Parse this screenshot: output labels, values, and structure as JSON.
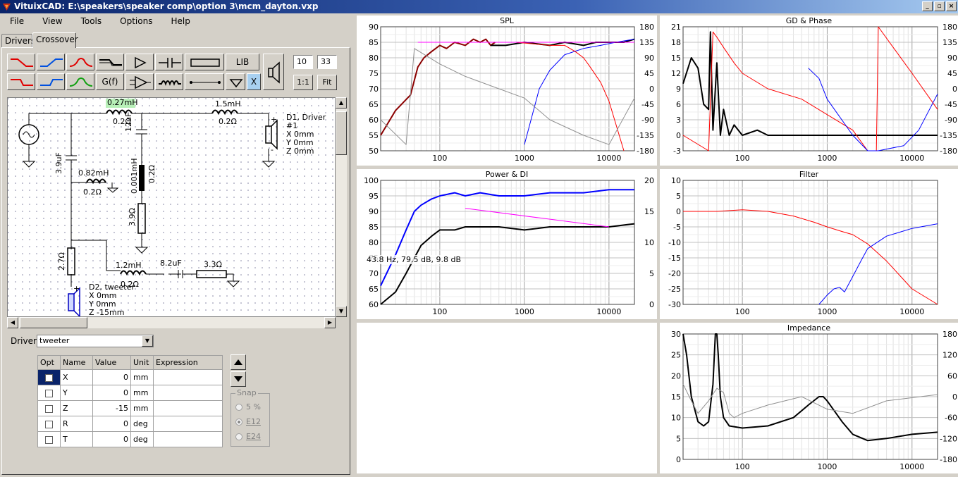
{
  "window": {
    "title": "VituixCAD: E:\\speakers\\speaker comp\\option 3\\mcm_dayton.vxp"
  },
  "menu": [
    "File",
    "View",
    "Tools",
    "Options",
    "Help"
  ],
  "tabs": [
    {
      "label": "Drivers"
    },
    {
      "label": "Crossover"
    }
  ],
  "toolbar": {
    "gf_label": "G(f)",
    "lib_label": "LIB",
    "x_label": "X",
    "one_to_one_label": "1:1",
    "fit_label": "Fit",
    "num1": "10",
    "num2": "33"
  },
  "schematic": {
    "labels": {
      "l1": "0.27mH",
      "l1r": "0.2Ω",
      "l2": "1.5mH",
      "l2r": "0.2Ω",
      "c1": "12uF",
      "c2": "3.9uF",
      "l3": "0.82mH",
      "l3r": "0.2Ω",
      "c3": "0.001mH",
      "c3r": "0.2Ω",
      "r1": "3.9Ω",
      "r2": "2.7Ω",
      "l4": "1.2mH",
      "l4r": "0.2Ω",
      "c4": "8.2uF",
      "r3": "3.3Ω"
    },
    "driver1": {
      "name": "D1, Driver #1",
      "x": "X 0mm",
      "y": "Y 0mm",
      "z": "Z 0mm"
    },
    "driver2": {
      "name": "D2, tweeter",
      "x": "X 0mm",
      "y": "Y 0mm",
      "z": "Z -15mm"
    }
  },
  "driver_select": {
    "label": "Driver",
    "value": "tweeter"
  },
  "param_table": {
    "headers": [
      "Opt",
      "Name",
      "Value",
      "Unit",
      "Expression"
    ],
    "rows": [
      {
        "name": "X",
        "value": "0",
        "unit": "mm"
      },
      {
        "name": "Y",
        "value": "0",
        "unit": "mm"
      },
      {
        "name": "Z",
        "value": "-15",
        "unit": "mm"
      },
      {
        "name": "R",
        "value": "0",
        "unit": "deg"
      },
      {
        "name": "T",
        "value": "0",
        "unit": "deg"
      }
    ]
  },
  "snap": {
    "label": "Snap",
    "options": [
      "5 %",
      "E12",
      "E24"
    ],
    "selected": "E12"
  },
  "chart_data": [
    {
      "title": "SPL",
      "type": "line",
      "x_scale": "log",
      "xlim": [
        20,
        20000
      ],
      "x_ticks": [
        "100",
        "1000",
        "10000"
      ],
      "y_left_ticks": [
        "90",
        "85",
        "80",
        "75",
        "70",
        "65",
        "60",
        "55",
        "50"
      ],
      "y_right_ticks": [
        "180",
        "135",
        "90",
        "45",
        "0",
        "-45",
        "-90",
        "-135",
        "-180"
      ],
      "colors": [
        "#000000",
        "#8b0000",
        "#0000ff",
        "#ff0000",
        "#ff00ff",
        "#909090"
      ],
      "series": [
        {
          "color": "#8b0000",
          "x": [
            20,
            30,
            45,
            55,
            65,
            80,
            100,
            120,
            150,
            200,
            250,
            300,
            350,
            400,
            450
          ],
          "values": [
            55,
            63,
            68,
            77,
            80,
            82,
            84,
            83,
            85,
            84,
            86,
            85,
            86,
            84,
            85
          ]
        },
        {
          "color": "#000000",
          "x": [
            400,
            600,
            1000,
            2000,
            3000,
            5000,
            7000,
            10000,
            15000,
            20000
          ],
          "values": [
            84,
            84,
            85,
            84,
            85,
            84,
            85,
            85,
            85,
            86
          ]
        },
        {
          "color": "#0000ff",
          "x": [
            1000,
            1500,
            2000,
            3000,
            5000,
            8000,
            12000,
            20000
          ],
          "values": [
            52,
            70,
            76,
            81,
            83,
            84,
            85,
            86
          ]
        },
        {
          "color": "#ff0000",
          "x": [
            800,
            2000,
            3000,
            4000,
            5000,
            6000,
            8000,
            10000,
            15000
          ],
          "values": [
            85,
            84,
            84,
            82,
            80,
            77,
            72,
            66,
            50
          ]
        },
        {
          "color": "#ff00ff",
          "x": [
            55,
            20000
          ],
          "values": [
            85,
            85
          ]
        },
        {
          "color": "#909090",
          "x": [
            20,
            40,
            50,
            100,
            200,
            500,
            1000,
            2000,
            5000,
            10000,
            20000
          ],
          "values": [
            60,
            52,
            83,
            78,
            74,
            70,
            67,
            60,
            55,
            52,
            67
          ]
        }
      ]
    },
    {
      "title": "GD & Phase",
      "type": "line",
      "x_scale": "log",
      "xlim": [
        20,
        20000
      ],
      "x_ticks": [
        "100",
        "1000",
        "10000"
      ],
      "y_left_ticks": [
        "21",
        "18",
        "15",
        "12",
        "9",
        "6",
        "3",
        "0",
        "-3"
      ],
      "y_right_ticks": [
        "180",
        "135",
        "90",
        "45",
        "0",
        "-45",
        "-90",
        "-135",
        "-180"
      ],
      "series": [
        {
          "color": "#000000",
          "x": [
            20,
            25,
            30,
            35,
            40,
            42,
            45,
            50,
            55,
            60,
            70,
            80,
            100,
            150,
            200,
            300,
            500,
            1000,
            5000,
            20000
          ],
          "values": [
            10,
            15,
            13,
            6,
            5,
            20,
            1,
            14,
            0,
            5,
            0,
            2,
            0,
            1,
            0,
            0,
            0,
            0,
            0,
            0
          ]
        },
        {
          "color": "#ff0000",
          "x": [
            20,
            40,
            45,
            50,
            60,
            80,
            100,
            200,
            500,
            1000,
            2000,
            3000,
            3800,
            4000,
            6000,
            10000,
            20000
          ],
          "values": [
            0,
            -3,
            20,
            19,
            17,
            14,
            12,
            9,
            7,
            4,
            1,
            -3,
            -3,
            21,
            17,
            12,
            5
          ]
        },
        {
          "color": "#0000ff",
          "x": [
            600,
            800,
            1000,
            2000,
            3000,
            4000,
            8000,
            12000,
            20000
          ],
          "values": [
            13,
            11,
            7,
            0,
            -3,
            -3,
            -2,
            1,
            8
          ]
        }
      ]
    },
    {
      "title": "Power & DI",
      "type": "line",
      "x_scale": "log",
      "xlim": [
        20,
        20000
      ],
      "x_ticks": [
        "100",
        "1000",
        "10000"
      ],
      "y_left_ticks": [
        "100",
        "95",
        "90",
        "85",
        "80",
        "75",
        "70",
        "65",
        "60"
      ],
      "y_right_ticks": [
        "20",
        "15",
        "10",
        "5",
        "0"
      ],
      "annotation": "43.8 Hz, 79.5 dB, 9.8 dB",
      "series": [
        {
          "color": "#0000ff",
          "x": [
            20,
            30,
            40,
            50,
            60,
            80,
            100,
            150,
            200,
            300,
            500,
            1000,
            2000,
            5000,
            10000,
            20000
          ],
          "values": [
            66,
            76,
            84,
            90,
            92,
            94,
            95,
            96,
            95,
            96,
            95,
            95,
            96,
            96,
            97,
            97
          ]
        },
        {
          "color": "#000000",
          "x": [
            20,
            30,
            40,
            50,
            60,
            80,
            100,
            150,
            200,
            300,
            500,
            1000,
            2000,
            5000,
            10000,
            20000
          ],
          "values": [
            60,
            64,
            70,
            75,
            79,
            82,
            84,
            84,
            85,
            85,
            85,
            84,
            85,
            85,
            85,
            86
          ]
        },
        {
          "color": "#ff00ff",
          "x": [
            200,
            10000
          ],
          "values": [
            91,
            85
          ]
        }
      ]
    },
    {
      "title": "Filter",
      "type": "line",
      "x_scale": "log",
      "xlim": [
        20,
        20000
      ],
      "x_ticks": [
        "100",
        "1000",
        "10000"
      ],
      "y_left_ticks": [
        "10",
        "5",
        "0",
        "-5",
        "-10",
        "-15",
        "-20",
        "-25",
        "-30"
      ],
      "series": [
        {
          "color": "#ff0000",
          "x": [
            20,
            50,
            100,
            200,
            400,
            700,
            1000,
            1500,
            2000,
            3000,
            5000,
            10000,
            20000
          ],
          "values": [
            0,
            0,
            0.5,
            0,
            -1.5,
            -3.5,
            -5,
            -6.5,
            -7.5,
            -10.5,
            -16,
            -25,
            -30
          ]
        },
        {
          "color": "#0000ff",
          "x": [
            800,
            1000,
            1200,
            1400,
            1600,
            2000,
            2500,
            3000,
            5000,
            10000,
            20000
          ],
          "values": [
            -30,
            -27,
            -25,
            -24.5,
            -26,
            -21,
            -16,
            -12,
            -8,
            -5.5,
            -4
          ]
        }
      ]
    },
    {
      "title": "Impedance",
      "type": "line",
      "x_scale": "log",
      "xlim": [
        20,
        20000
      ],
      "x_ticks": [
        "100",
        "1000",
        "10000"
      ],
      "y_left_ticks": [
        "30",
        "25",
        "20",
        "15",
        "10",
        "5",
        "0"
      ],
      "y_right_ticks": [
        "180",
        "120",
        "60",
        "0",
        "-60",
        "-120",
        "-180"
      ],
      "series": [
        {
          "color": "#000000",
          "x": [
            20,
            22,
            25,
            30,
            35,
            40,
            45,
            48,
            50,
            52,
            55,
            60,
            70,
            100,
            200,
            400,
            600,
            800,
            900,
            1000,
            1500,
            2000,
            3000,
            5000,
            10000,
            20000
          ],
          "values": [
            30,
            25,
            15,
            9,
            8,
            9,
            18,
            30,
            30,
            25,
            15,
            10,
            8,
            7.5,
            8,
            10,
            13,
            15,
            15,
            14,
            9,
            6,
            4.5,
            5,
            6,
            6.5
          ]
        },
        {
          "color": "#909090",
          "x": [
            20,
            25,
            30,
            40,
            50,
            60,
            70,
            80,
            100,
            200,
            500,
            1000,
            2000,
            5000,
            20000
          ],
          "values": [
            18,
            14,
            11,
            14,
            17,
            16,
            11,
            10,
            11,
            13,
            15,
            12,
            11,
            14,
            15.5
          ]
        }
      ]
    }
  ]
}
